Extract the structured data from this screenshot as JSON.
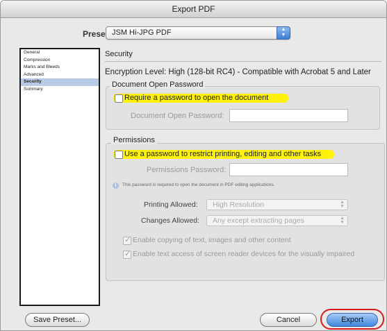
{
  "window": {
    "title": "Export PDF"
  },
  "preset": {
    "label": "Preset:",
    "value": "JSM Hi-JPG PDF"
  },
  "sidebar": {
    "items": [
      {
        "label": "General"
      },
      {
        "label": "Compression"
      },
      {
        "label": "Marks and Bleeds"
      },
      {
        "label": "Advanced"
      },
      {
        "label": "Security",
        "selected": true
      },
      {
        "label": "Summary"
      }
    ]
  },
  "security": {
    "heading": "Security",
    "encryption_level": "Encryption Level: High (128-bit RC4) - Compatible with Acrobat 5 and Later",
    "open_password": {
      "group_title": "Document Open Password",
      "checkbox_label": "Require a password to open the document",
      "checked": false,
      "field_label": "Document Open Password:",
      "field_value": ""
    },
    "permissions": {
      "group_title": "Permissions",
      "checkbox_label": "Use a password to restrict printing, editing and other tasks",
      "checked": false,
      "field_label": "Permissions Password:",
      "field_value": "",
      "info_text": "This password is required to open the document in PDF editing applications.",
      "printing_label": "Printing Allowed:",
      "printing_value": "High Resolution",
      "changes_label": "Changes Allowed:",
      "changes_value": "Any except extracting pages",
      "copy_label": "Enable copying of text, images and other content",
      "copy_checked": true,
      "screen_reader_label": "Enable text access of screen reader devices for the visually impaired",
      "screen_reader_checked": true
    }
  },
  "buttons": {
    "save_preset": "Save Preset...",
    "cancel": "Cancel",
    "export": "Export"
  },
  "colors": {
    "highlight": "#fff200",
    "export_ring": "#d41c1c",
    "selection": "#b7cbe6"
  }
}
